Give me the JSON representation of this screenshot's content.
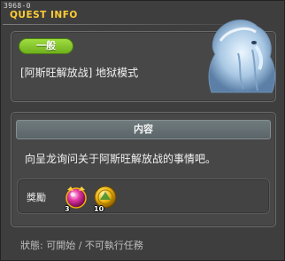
{
  "window": {
    "quest_id": "3968-0",
    "title": "QUEST INFO"
  },
  "quest": {
    "category_badge": "一般",
    "name": "[阿斯旺解放战] 地狱模式",
    "npc_icon": "ghost-npc-portrait"
  },
  "content": {
    "header": "内容",
    "description": "向呈龙询问关于阿斯旺解放战的事情吧。"
  },
  "rewards": {
    "label": "獎勵",
    "items": [
      {
        "icon": "pink-gem-item-icon",
        "quantity": "3"
      },
      {
        "icon": "gold-coin-item-icon",
        "quantity": "10"
      }
    ]
  },
  "status": {
    "text": "狀態: 可開始 / 不可執行任務"
  },
  "colors": {
    "title": "#ffcc33",
    "badge": "#8cc832",
    "panel": "#474747",
    "header": "#6a7579"
  }
}
